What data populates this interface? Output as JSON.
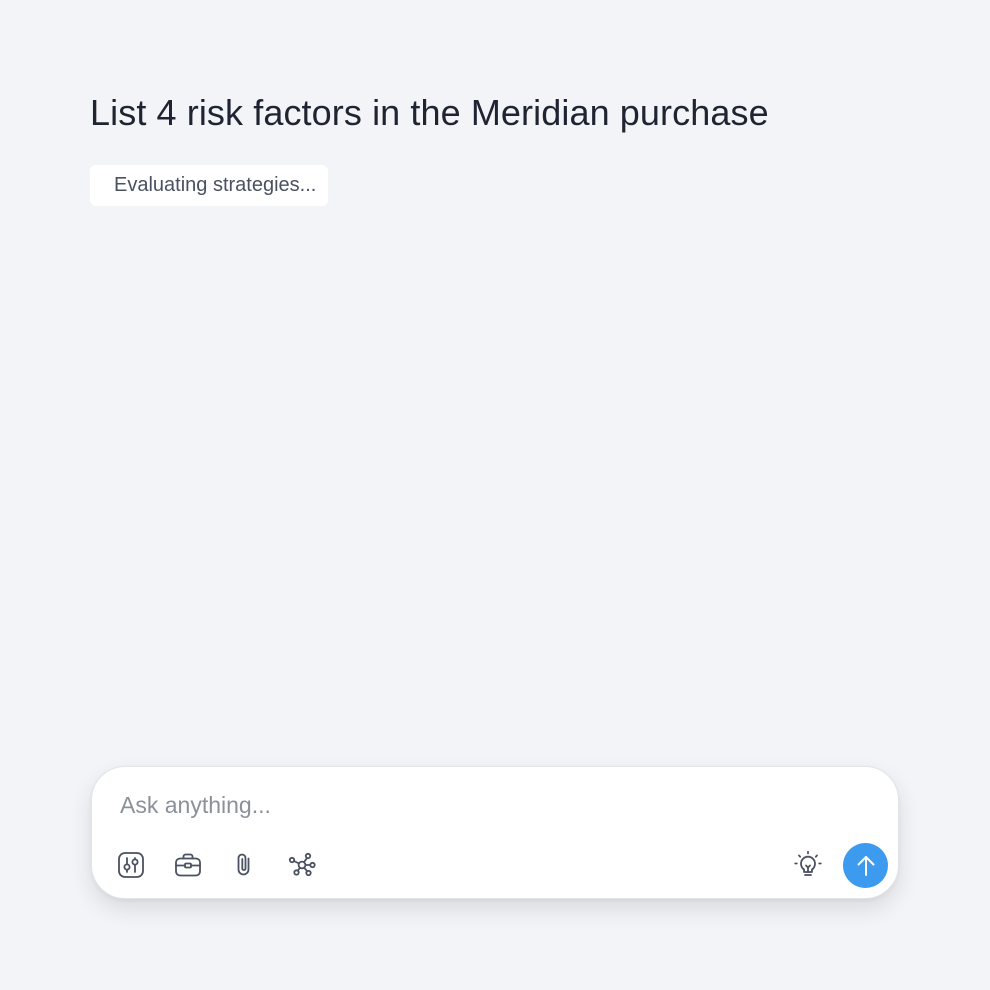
{
  "conversation": {
    "query": "List 4 risk factors in the Meridian purchase",
    "status": "Evaluating strategies..."
  },
  "composer": {
    "placeholder": "Ask anything...",
    "value": "",
    "tools": [
      {
        "icon": "sliders-icon"
      },
      {
        "icon": "briefcase-icon"
      },
      {
        "icon": "paperclip-icon"
      },
      {
        "icon": "graph-network-icon"
      }
    ],
    "idea_icon": "lightbulb-icon",
    "send_icon": "arrow-up-icon"
  },
  "colors": {
    "background": "#f3f4f7",
    "text": "#1f2433",
    "muted_text": "#4a5160",
    "placeholder": "#8b909b",
    "icon": "#4a5160",
    "accent": "#3d9bef"
  }
}
